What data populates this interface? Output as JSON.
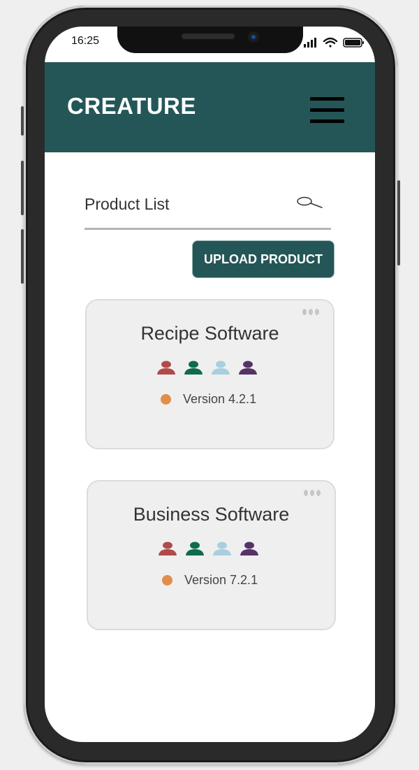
{
  "status_bar": {
    "time": "16:25"
  },
  "header": {
    "title": "CREATURE",
    "icon": "hamburger-menu-icon",
    "color": "#245658"
  },
  "search": {
    "placeholder": "Product List",
    "icon": "search-icon"
  },
  "upload_button": {
    "label": "UPLOAD PRODUCT"
  },
  "products": [
    {
      "name": "Recipe Software",
      "version": "Version 4.2.1",
      "status_color": "#e08f4a",
      "member_colors": [
        "#b14a4a",
        "#0f6b4e",
        "#a8cfe0",
        "#553366"
      ]
    },
    {
      "name": "Business Software",
      "version": "Version 7.2.1",
      "status_color": "#e08f4a",
      "member_colors": [
        "#b14a4a",
        "#0f6b4e",
        "#a8cfe0",
        "#553366"
      ]
    }
  ]
}
